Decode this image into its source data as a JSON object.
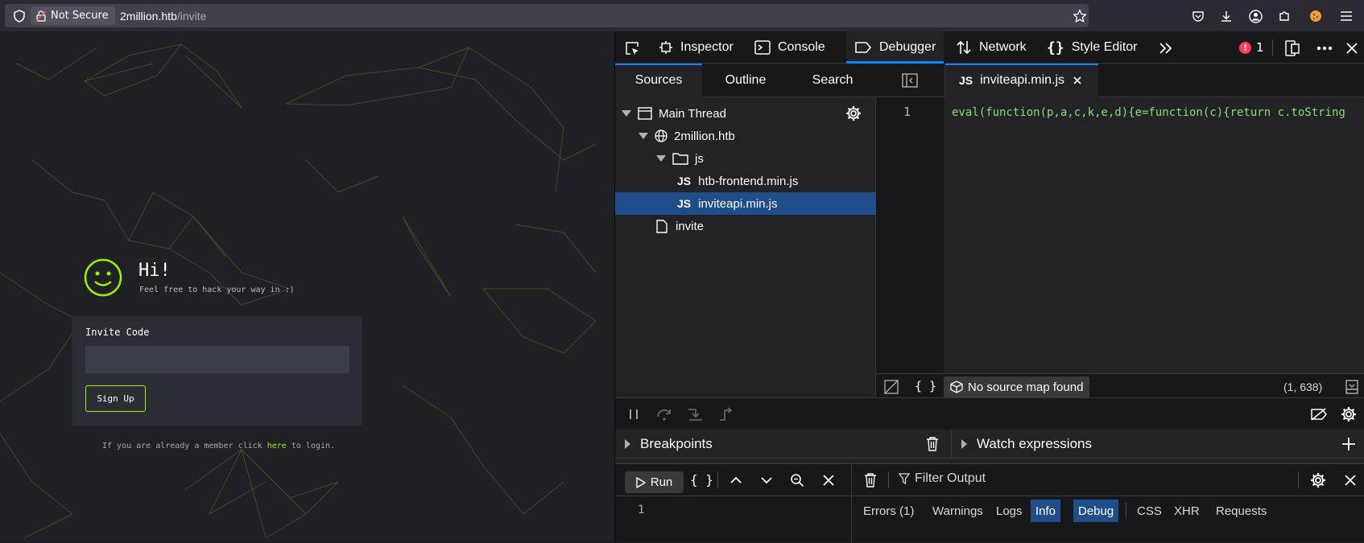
{
  "browser": {
    "security_label": "Not Secure",
    "url_host": "2million.htb",
    "url_path": "/invite"
  },
  "site": {
    "greeting": "Hi!",
    "subtitle": "Feel free to hack your way in :)",
    "invite_label": "Invite Code",
    "invite_value": "",
    "signup_label": "Sign Up",
    "login_prefix": "If you are already a member click ",
    "login_link": "here",
    "login_suffix": " to login.",
    "accent_color": "#9fef00"
  },
  "devtools": {
    "tabs": [
      {
        "label": "Inspector",
        "icon": "inspector-icon"
      },
      {
        "label": "Console",
        "icon": "console-icon"
      },
      {
        "label": "Debugger",
        "icon": "debugger-icon",
        "selected": true
      },
      {
        "label": "Network",
        "icon": "network-icon"
      },
      {
        "label": "Style Editor",
        "icon": "style-editor-icon"
      }
    ],
    "error_count": "1",
    "source_tabs": [
      "Sources",
      "Outline",
      "Search"
    ],
    "tree": {
      "main_thread": "Main Thread",
      "host": "2million.htb",
      "folder": "js",
      "file1": "htb-frontend.min.js",
      "file2": "inviteapi.min.js",
      "file3": "invite"
    },
    "js_badge": "JS",
    "editor": {
      "open_file": "inviteapi.min.js",
      "line_number": "1",
      "code_line": "eval(function(p,a,c,k,e,d){e=function(c){return c.toString",
      "no_source_map": "No source map found",
      "cursor_position": "(1, 638)",
      "pretty_print": "{ }"
    },
    "panes": {
      "breakpoints": "Breakpoints",
      "watch": "Watch expressions"
    },
    "console": {
      "run_label": "Run",
      "filter_placeholder": "Filter Output",
      "input_line": "1",
      "filters": [
        "Errors (1)",
        "Warnings",
        "Logs",
        "Info",
        "Debug",
        "CSS",
        "XHR",
        "Requests"
      ],
      "active_filters": [
        "Info",
        "Debug"
      ],
      "braces": "{ }"
    }
  }
}
